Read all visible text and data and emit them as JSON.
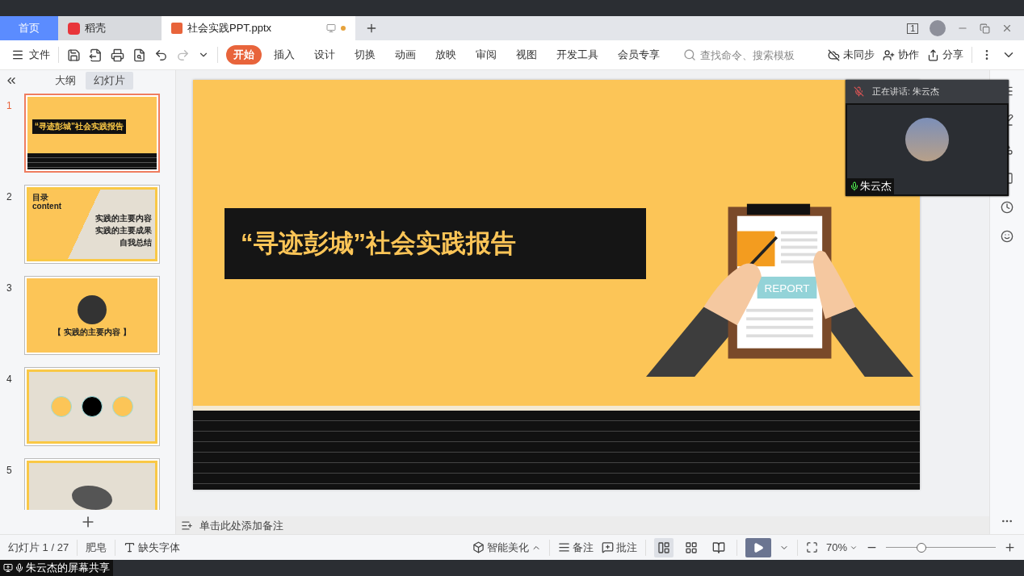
{
  "tabs": [
    {
      "label": "首页",
      "kind": "home",
      "selected": false
    },
    {
      "label": "稻壳",
      "kind": "docer",
      "selected": false
    },
    {
      "label": "社会实践PPT.pptx",
      "kind": "doc",
      "selected": true
    }
  ],
  "title_bar": {
    "window_badge": "1"
  },
  "menu": {
    "file": "文件",
    "ribbon_tabs": [
      {
        "label": "开始",
        "selected": true
      },
      {
        "label": "插入",
        "selected": false
      },
      {
        "label": "设计",
        "selected": false
      },
      {
        "label": "切换",
        "selected": false
      },
      {
        "label": "动画",
        "selected": false
      },
      {
        "label": "放映",
        "selected": false
      },
      {
        "label": "审阅",
        "selected": false
      },
      {
        "label": "视图",
        "selected": false
      },
      {
        "label": "开发工具",
        "selected": false
      },
      {
        "label": "会员专享",
        "selected": false
      }
    ],
    "search": {
      "placeholder": "查找命令、搜索模板"
    },
    "actions": [
      {
        "kind": "sync",
        "label": "未同步"
      },
      {
        "kind": "collab",
        "label": "协作"
      },
      {
        "kind": "share",
        "label": "分享"
      }
    ]
  },
  "panel": {
    "view_tabs": [
      {
        "label": "大纲",
        "selected": false
      },
      {
        "label": "幻灯片",
        "selected": true
      }
    ],
    "slides": [
      {
        "number": "1",
        "kind": "cover",
        "selected": true,
        "texts": [
          "“寻迹彭城”社会实践报告"
        ]
      },
      {
        "number": "2",
        "kind": "contents",
        "selected": false,
        "texts": [
          "目录",
          "content",
          "实践的主要内容",
          "实践的主要成果",
          "自我总结"
        ]
      },
      {
        "number": "3",
        "kind": "section",
        "selected": false,
        "texts": [
          "【 实践的主要内容 】"
        ]
      },
      {
        "number": "4",
        "kind": "circles",
        "selected": false
      },
      {
        "number": "5",
        "kind": "map",
        "selected": false
      }
    ]
  },
  "slide": {
    "title": "“寻迹彭城”社会实践报告",
    "report": "REPORT"
  },
  "notes": {
    "placeholder": "单击此处添加备注"
  },
  "meeting": {
    "speaking": "正在讲话: 朱云杰",
    "name": "朱云杰",
    "muted": true
  },
  "status_bar": {
    "slide_counter": "幻灯片 1 / 27",
    "theme": "肥皂",
    "missing_fonts": "缺失字体",
    "beautify": "智能美化",
    "notes": "备注",
    "comments": "批注",
    "view_modes": [
      {
        "kind": "normal",
        "selected": true
      },
      {
        "kind": "sorter",
        "selected": false
      },
      {
        "kind": "reading",
        "selected": false
      }
    ],
    "zoom": "70%",
    "zoom_slider": {
      "level": 0.32
    }
  },
  "share_label": "朱云杰的屏幕共享"
}
